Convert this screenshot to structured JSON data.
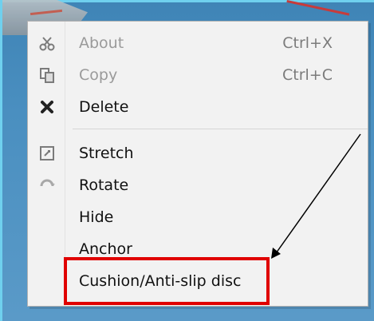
{
  "menu": {
    "items": [
      {
        "label": "About",
        "shortcut": "Ctrl+X",
        "icon": "cut-icon",
        "enabled": false
      },
      {
        "label": "Copy",
        "shortcut": "Ctrl+C",
        "icon": "copy-icon",
        "enabled": false
      },
      {
        "label": "Delete",
        "shortcut": "",
        "icon": "delete-x-icon",
        "enabled": true
      },
      {
        "label": "Stretch",
        "shortcut": "",
        "icon": "stretch-icon",
        "enabled": true
      },
      {
        "label": "Rotate",
        "shortcut": "",
        "icon": "rotate-icon",
        "enabled": true
      },
      {
        "label": "Hide",
        "shortcut": "",
        "icon": "",
        "enabled": true
      },
      {
        "label": "Anchor",
        "shortcut": "",
        "icon": "",
        "enabled": true
      },
      {
        "label": "Cushion/Anti-slip disc",
        "shortcut": "",
        "icon": "",
        "enabled": true
      }
    ]
  },
  "annotation": {
    "highlight_color": "#e00000",
    "arrow_color": "#000000"
  }
}
